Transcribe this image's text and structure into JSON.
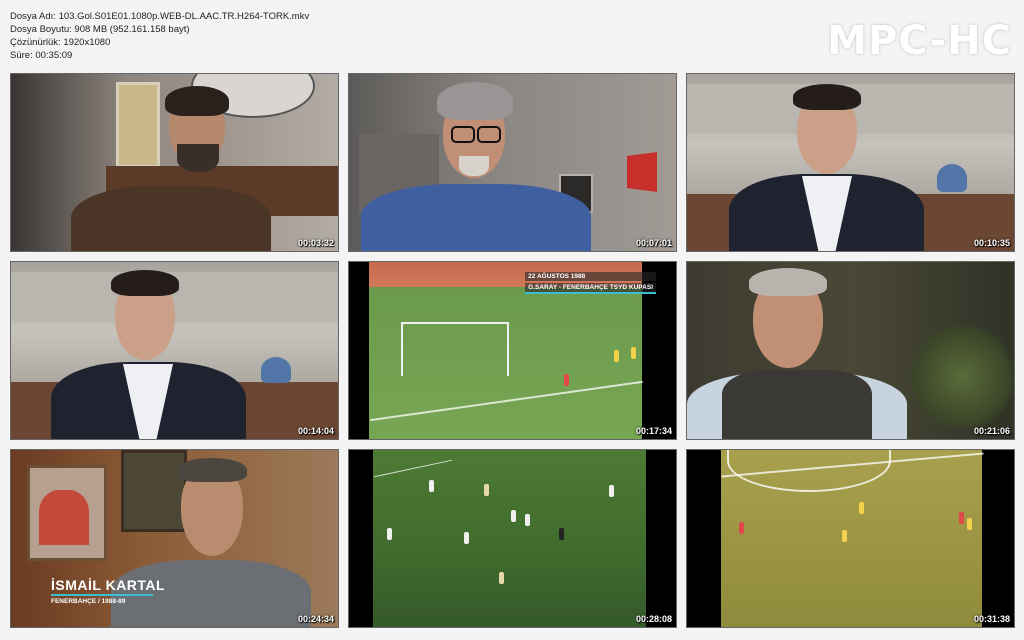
{
  "file_info": {
    "name_line": "Dosya Adı: 103.Gol.S01E01.1080p.WEB-DL.AAC.TR.H264-TORK.mkv",
    "size_line": "Dosya Boyutu: 908 MB (952.161.158 bayt)",
    "resolution_line": "Çözünürlük: 1920x1080",
    "duration_line": "Süre: 00:35:09"
  },
  "brand": "MPC-HC",
  "thumbnails": [
    {
      "timestamp": "00:03:32"
    },
    {
      "timestamp": "00:07:01"
    },
    {
      "timestamp": "00:10:35"
    },
    {
      "timestamp": "00:14:04"
    },
    {
      "timestamp": "00:17:34",
      "caption_date": "22 AĞUSTOS 1988",
      "caption_match": "G.SARAY - FENERBAHÇE TSYD KUPASI"
    },
    {
      "timestamp": "00:21:06"
    },
    {
      "timestamp": "00:24:34",
      "person_name": "İSMAİL KARTAL",
      "person_sub": "FENERBAHÇE / 1988-89"
    },
    {
      "timestamp": "00:28:08"
    },
    {
      "timestamp": "00:31:38"
    }
  ]
}
